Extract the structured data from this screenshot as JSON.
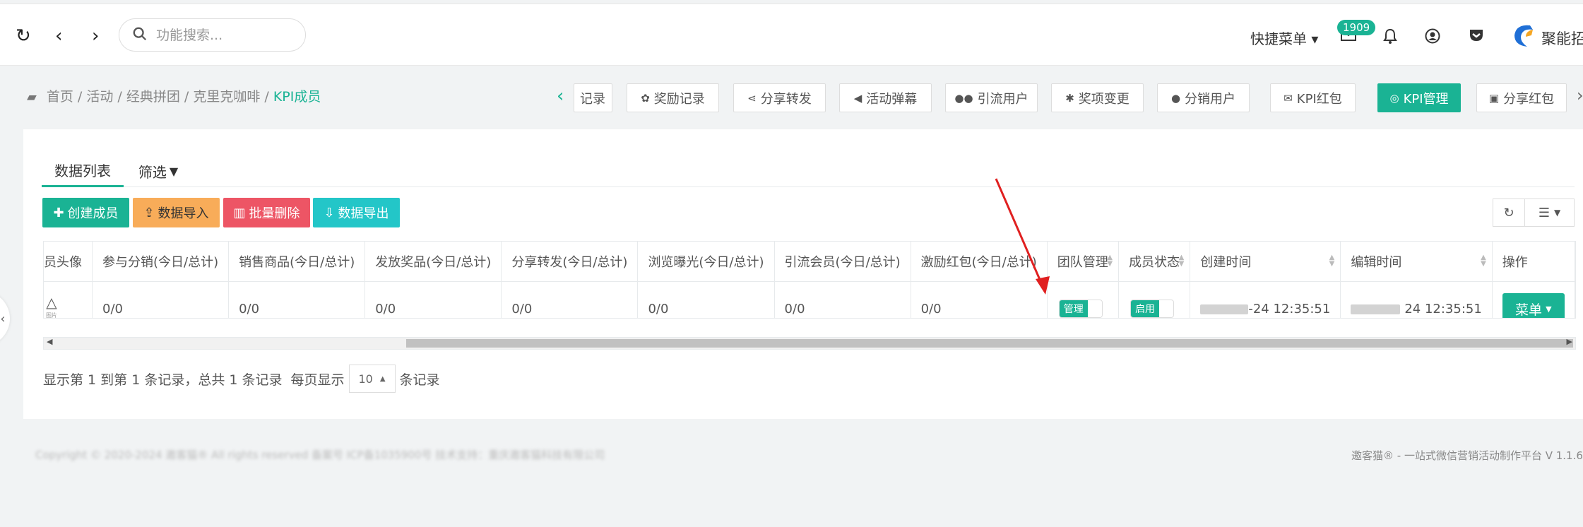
{
  "search": {
    "placeholder": "功能搜索..."
  },
  "topbar": {
    "quick_menu": "快捷菜单",
    "mail_badge": "1909",
    "brand": "聚能招"
  },
  "breadcrumb": {
    "items": [
      "首页",
      "活动",
      "经典拼团",
      "克里克咖啡"
    ],
    "active": "KPI成员",
    "sep": " / "
  },
  "page_tabs": [
    {
      "label": "记录",
      "icon": "record-icon"
    },
    {
      "label": "奖励记录",
      "icon": "gift-icon"
    },
    {
      "label": "分享转发",
      "icon": "share-icon"
    },
    {
      "label": "活动弹幕",
      "icon": "bullhorn-icon"
    },
    {
      "label": "引流用户",
      "icon": "users-icon"
    },
    {
      "label": "奖项变更",
      "icon": "bug-icon"
    },
    {
      "label": "分销用户",
      "icon": "user-icon"
    },
    {
      "label": "KPI红包",
      "icon": "envelope-icon"
    },
    {
      "label": "KPI管理",
      "icon": "target-icon",
      "active": true
    },
    {
      "label": "分享红包",
      "icon": "money-icon"
    }
  ],
  "content_tabs": {
    "list": "数据列表",
    "filter": "筛选"
  },
  "actions": {
    "create": "创建成员",
    "import": "数据导入",
    "batch_delete": "批量删除",
    "export": "数据导出"
  },
  "table": {
    "headers": [
      "员头像",
      "参与分销(今日/总计)",
      "销售商品(今日/总计)",
      "发放奖品(今日/总计)",
      "分享转发(今日/总计)",
      "浏览曝光(今日/总计)",
      "引流会员(今日/总计)",
      "激励红包(今日/总计)",
      "团队管理",
      "成员状态",
      "创建时间",
      "编辑时间",
      "操作"
    ],
    "row": {
      "avatar_sub": "图片",
      "distribution": "0/0",
      "sales": "0/0",
      "prizes": "0/0",
      "shares": "0/0",
      "views": "0/0",
      "members": "0/0",
      "redpacket": "0/0",
      "team_toggle": "管理",
      "status_toggle": "启用",
      "created_suffix": "-24 12:35:51",
      "edited_suffix": "24 12:35:51",
      "menu": "菜单"
    }
  },
  "pager": {
    "info": "显示第 1 到第 1 条记录，总共 1 条记录",
    "per_page_prefix": "每页显示",
    "per_page": "10",
    "per_page_suffix": "条记录"
  },
  "footer": {
    "left": "Copyright © 2020-2024 邀客猫® All rights reserved 备案号 ICP备1035900号 技术支持：重庆邀客猫科技有限公司",
    "right": "邀客猫® - 一站式微信营销活动制作平台 V 1.1.6"
  },
  "colors": {
    "accent": "#1ab394",
    "warning": "#f8ac59",
    "danger": "#ed5565",
    "info": "#23c6c8",
    "annotation": "#e02020"
  }
}
